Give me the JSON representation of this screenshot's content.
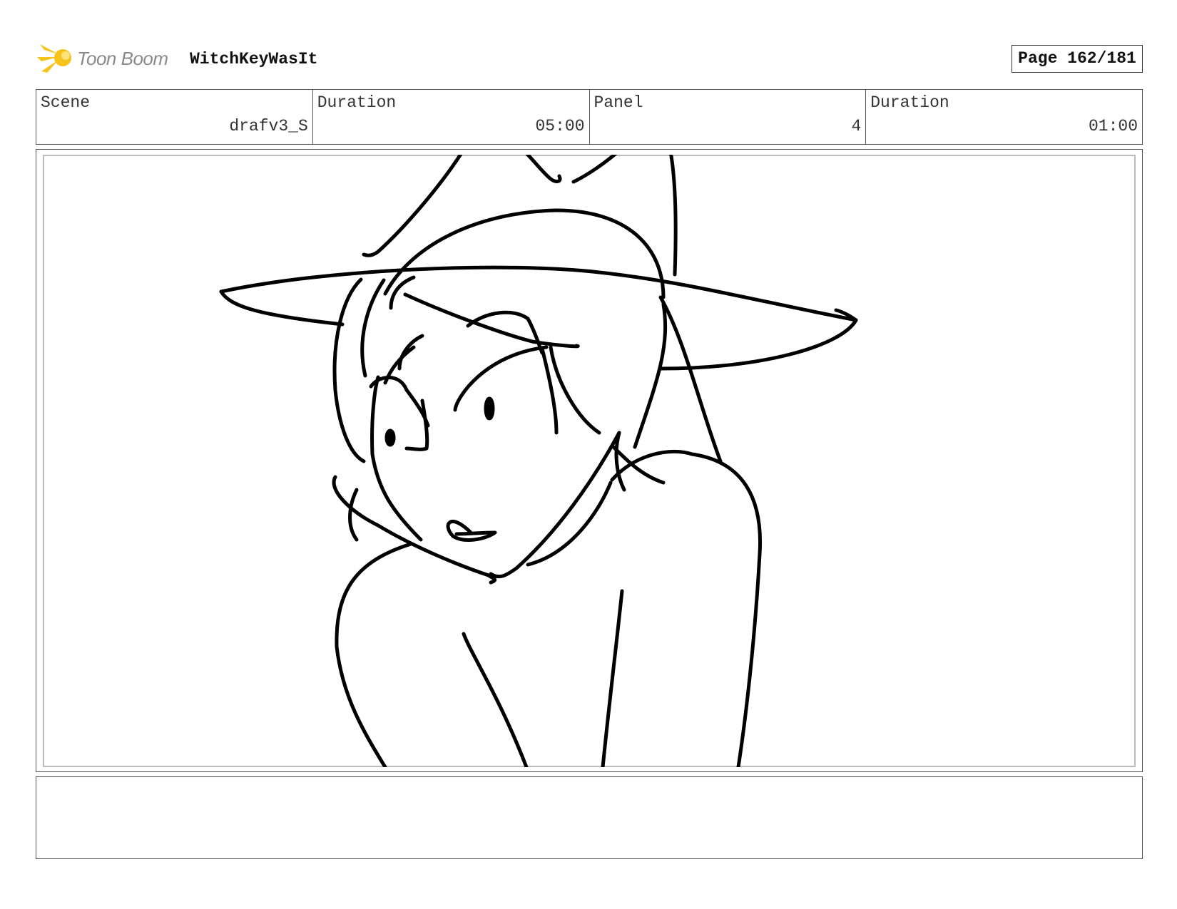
{
  "header": {
    "logo_text": "Toon Boom",
    "project_title": "WitchKeyWasIt",
    "page_label": "Page 162/181"
  },
  "info": {
    "scene_label": "Scene",
    "scene_value": "drafv3_S",
    "scene_duration_label": "Duration",
    "scene_duration_value": "05:00",
    "panel_label": "Panel",
    "panel_value": "4",
    "panel_duration_label": "Duration",
    "panel_duration_value": "01:00"
  },
  "notes": {
    "text": ""
  },
  "colors": {
    "logo_accent": "#f6c31a",
    "logo_text": "#8a8a8a",
    "ink": "#000000"
  }
}
